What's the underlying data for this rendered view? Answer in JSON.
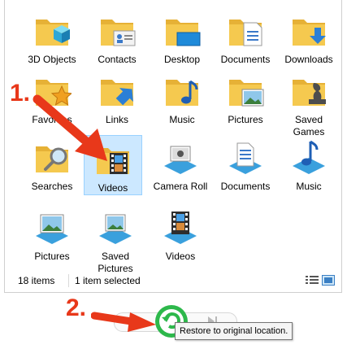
{
  "items": [
    {
      "label": "3D Objects",
      "icon": "3d-objects-folder-icon"
    },
    {
      "label": "Contacts",
      "icon": "contacts-folder-icon"
    },
    {
      "label": "Desktop",
      "icon": "desktop-folder-icon"
    },
    {
      "label": "Documents",
      "icon": "documents-folder-icon"
    },
    {
      "label": "Downloads",
      "icon": "downloads-folder-icon"
    },
    {
      "label": "Favorites",
      "icon": "favorites-folder-icon"
    },
    {
      "label": "Links",
      "icon": "links-folder-icon"
    },
    {
      "label": "Music",
      "icon": "music-folder-icon"
    },
    {
      "label": "Pictures",
      "icon": "pictures-folder-icon"
    },
    {
      "label": "Saved Games",
      "icon": "saved-games-folder-icon"
    },
    {
      "label": "Searches",
      "icon": "searches-folder-icon"
    },
    {
      "label": "Videos",
      "icon": "videos-folder-icon",
      "selected": true
    },
    {
      "label": "Camera Roll",
      "icon": "camera-roll-library-icon"
    },
    {
      "label": "Documents",
      "icon": "documents-library-icon"
    },
    {
      "label": "Music",
      "icon": "music-library-icon"
    },
    {
      "label": "Pictures",
      "icon": "pictures-library-icon"
    },
    {
      "label": "Saved Pictures",
      "icon": "saved-pictures-library-icon"
    },
    {
      "label": "Videos",
      "icon": "videos-library-icon"
    }
  ],
  "status": {
    "count": "18 items",
    "selection": "1 item selected"
  },
  "annotations": {
    "step1": "1.",
    "step2": "2."
  },
  "tooltip": {
    "text": "Restore to original location."
  },
  "colors": {
    "folder": "#f5c94f",
    "folder_dark": "#e6b136",
    "selection": "#cce8ff",
    "arrow": "#e8381a",
    "restore_green": "#2db84b"
  }
}
